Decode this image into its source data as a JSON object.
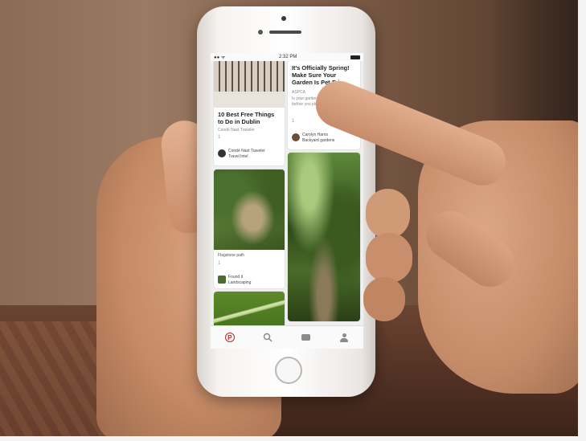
{
  "scene": {
    "description_colors": {
      "wall": "#8c6b55",
      "floor": "#4e2f22",
      "phone_body": "#f6f3f0",
      "accent": "#c8232c"
    }
  },
  "status_bar": {
    "time": "2:32 PM",
    "signal": "●● ᯤ"
  },
  "feed": {
    "left_column": [
      {
        "title": "10 Best Free Things to Do in Dublin",
        "source": "Condé Nast Traveler",
        "repins": "1",
        "pinner": "Condé Nast Traveler",
        "board": "Travel Intel"
      },
      {
        "title": "",
        "caption": "Flagstone path",
        "repins": "1",
        "pinner": "Found it",
        "board": "Landscaping"
      },
      {
        "title": ""
      }
    ],
    "right_column": [
      {
        "title": "It's Officially Spring! Make Sure Your Garden Is Pet-Fri...",
        "source": "ASPCA",
        "description": "Is your garden... make sure you ... before you plant",
        "repins": "1",
        "pinner": "Carolyn Harris",
        "board": "Backyard gardens"
      },
      {
        "title": ""
      }
    ]
  },
  "tabbar": {
    "home_label": "P",
    "items": [
      "home-icon",
      "search-icon",
      "messages-icon",
      "profile-icon"
    ]
  }
}
